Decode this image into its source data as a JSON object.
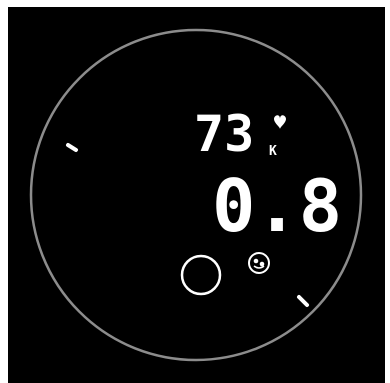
{
  "watch": {
    "heart_rate": "73",
    "heart_rate_unit": "K",
    "main_value": "0.8",
    "icons": {
      "heart": "heart-icon",
      "face_badge": "face-badge-icon",
      "ring_button": "ring-button-icon",
      "ticks": [
        "tick-mark-left",
        "tick-mark-right"
      ]
    },
    "colors": {
      "background": "#000000",
      "dial_ring": "#8c8c8c",
      "foreground": "#ffffff"
    }
  }
}
